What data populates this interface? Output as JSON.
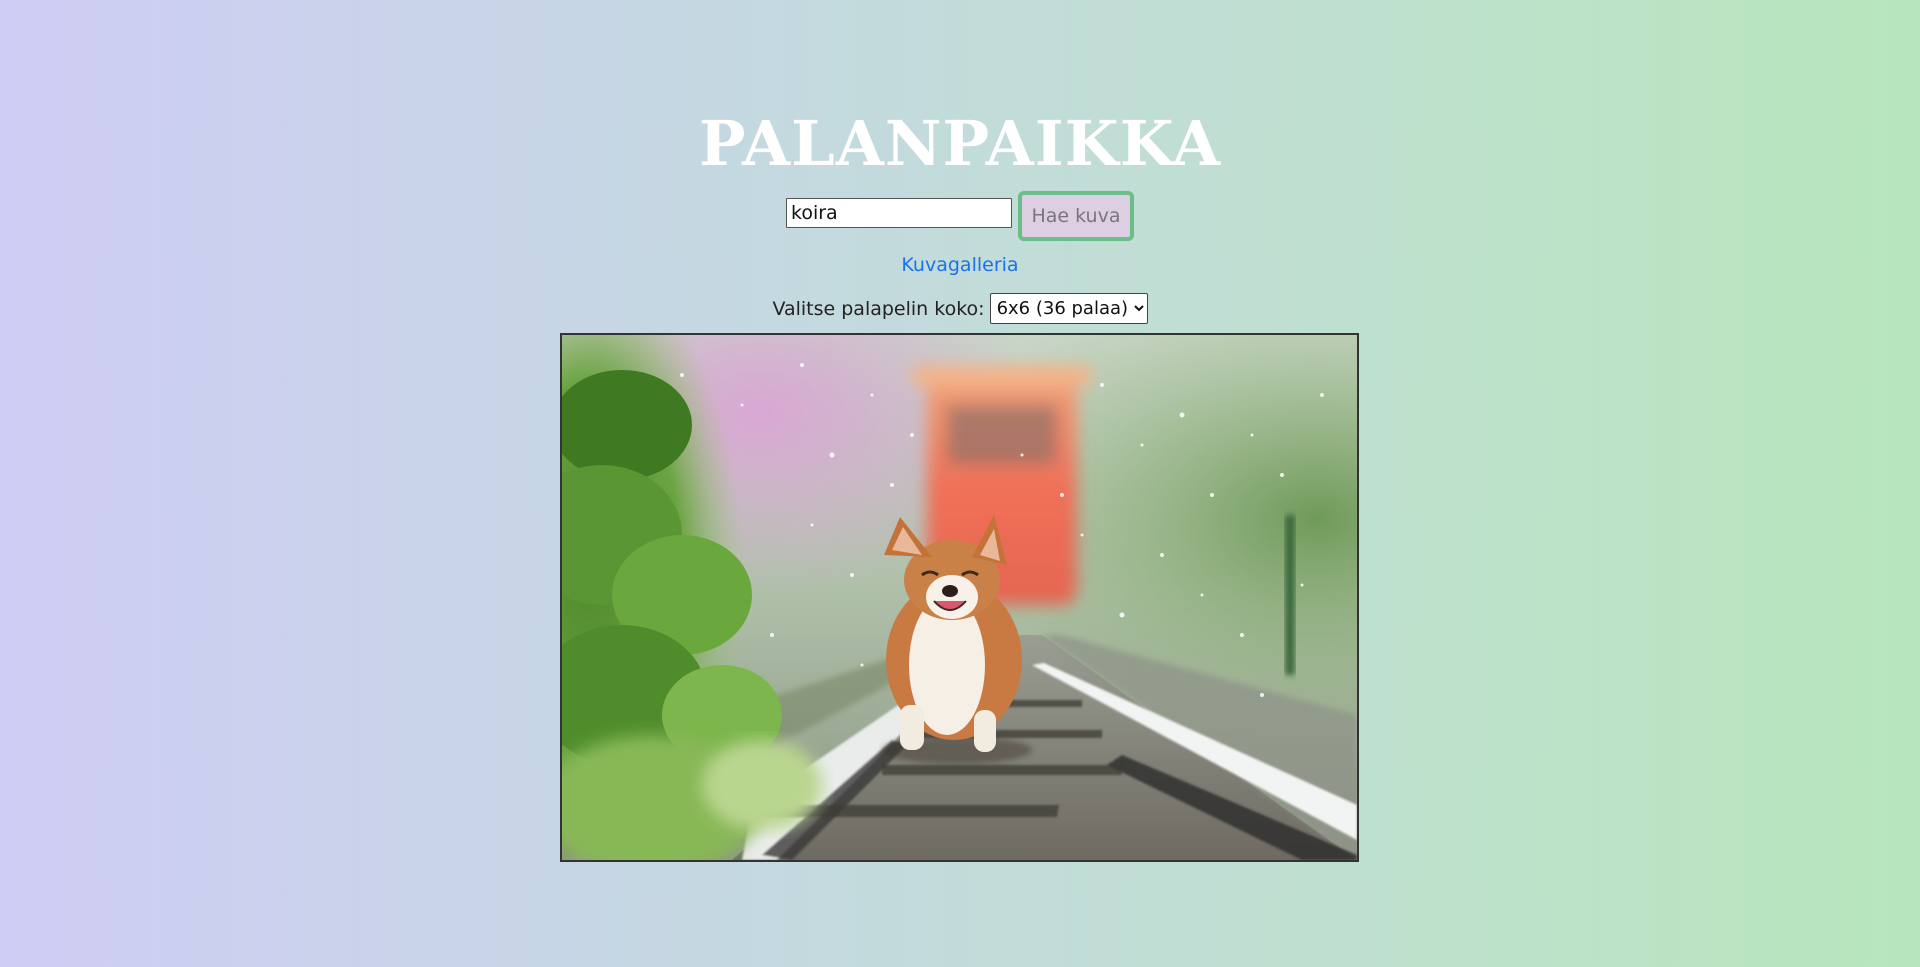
{
  "header": {
    "title": "PALANPAIKKA"
  },
  "search": {
    "value": "koira",
    "button_label": "Hae kuva"
  },
  "nav": {
    "gallery_link": "Kuvagalleria"
  },
  "puzzle_size": {
    "label": "Valitse palapelin koko:",
    "selected": "6x6 (36 palaa)"
  },
  "image": {
    "subject": "corgi-dog-on-railway-tracks"
  },
  "colors": {
    "title": "#ffffff",
    "link": "#1a73e8",
    "button_bg": "#dccfe2",
    "button_border": "#6cbd8a"
  }
}
